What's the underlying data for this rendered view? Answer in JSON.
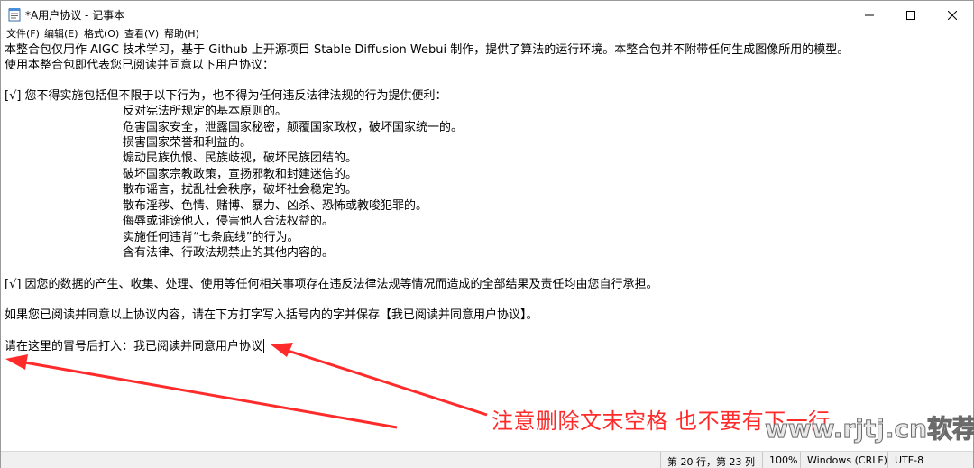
{
  "window": {
    "title": "*A用户协议 - 记事本",
    "icon": "notepad-icon",
    "controls": {
      "minimize": "minimize-icon",
      "maximize": "maximize-icon",
      "close": "close-icon"
    }
  },
  "menu": [
    "文件(F)",
    "编辑(E)",
    "格式(O)",
    "查看(V)",
    "帮助(H)"
  ],
  "editor": {
    "lines": [
      "本整合包仅用作 AIGC 技术学习，基于 Github 上开源项目 Stable Diffusion Webui 制作，提供了算法的运行环境。本整合包并不附带任何生成图像所用的模型。",
      "使用本整合包即代表您已阅读并同意以下用户协议：",
      "[√] 您不得实施包括但不限于以下行为，也不得为任何违反法律法规的行为提供便利：",
      "反对宪法所规定的基本原则的。",
      "危害国家安全，泄露国家秘密，颠覆国家政权，破坏国家统一的。",
      "损害国家荣誉和利益的。",
      "煽动民族仇恨、民族歧视，破坏民族团结的。",
      "破坏国家宗教政策，宣扬邪教和封建迷信的。",
      "散布谣言，扰乱社会秩序，破坏社会稳定的。",
      "散布淫秽、色情、赌博、暴力、凶杀、恐怖或教唆犯罪的。",
      "侮辱或诽谤他人，侵害他人合法权益的。",
      "实施任何违背“七条底线”的行为。",
      "含有法律、行政法规禁止的其他内容的。",
      "[√] 因您的数据的产生、收集、处理、使用等任何相关事项存在违反法律法规等情况而造成的全部结果及责任均由您自行承担。",
      "如果您已阅读并同意以上协议内容，请在下方打字写入括号内的字并保存【我已阅读并同意用户协议】。",
      "请在这里的冒号后打入：我已阅读并同意用户协议"
    ]
  },
  "annotation": {
    "text": "注意删除文末空格  也不要有下一行",
    "color": "#ff2b2b"
  },
  "watermark": "www.rjtj.cn软荐网",
  "status": {
    "position": "第 20 行，第 23 列",
    "zoom": "100%",
    "line_ending": "Windows (CRLF)",
    "encoding": "UTF-8"
  }
}
